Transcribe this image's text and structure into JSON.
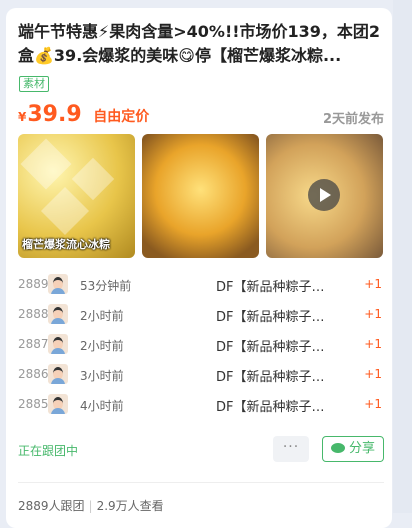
{
  "title": "端午节特惠⚡果肉含量>40%!!市场价139，本团2盒💰39.会爆浆的美味😋停【榴芒爆浆冰粽...",
  "tag": "素材",
  "price": {
    "symbol": "¥",
    "value": "39.9",
    "type": "自由定价"
  },
  "publish_time": "2天前发布",
  "images": [
    {
      "caption": "榴芒爆浆流心冰粽"
    },
    {
      "caption": ""
    },
    {
      "caption": "",
      "has_play": true
    }
  ],
  "followers": [
    {
      "no": "2889",
      "time": "53分钟前",
      "desc": "DF【新品种粽子…",
      "plus": "+1"
    },
    {
      "no": "2888",
      "time": "2小时前",
      "desc": "DF【新品种粽子…",
      "plus": "+1"
    },
    {
      "no": "2887",
      "time": "2小时前",
      "desc": "DF【新品种粽子…",
      "plus": "+1"
    },
    {
      "no": "2886",
      "time": "3小时前",
      "desc": "DF【新品种粽子…",
      "plus": "+1"
    },
    {
      "no": "2885",
      "time": "4小时前",
      "desc": "DF【新品种粽子…",
      "plus": "+1"
    }
  ],
  "status": "正在跟团中",
  "more_label": "···",
  "share_label": "分享",
  "footer": {
    "follow_count": "2889人跟团",
    "views": "2.9万人查看"
  },
  "colors": {
    "accent": "#ff5a1f",
    "green": "#47b86b"
  }
}
